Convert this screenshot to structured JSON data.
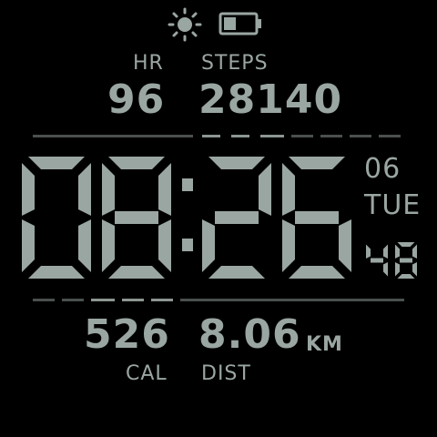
{
  "status": {
    "weather_icon": "sun-icon",
    "battery_icon": "battery-icon",
    "battery_level_fraction": 0.4
  },
  "colors": {
    "segment": "#9aa6a1",
    "background": "#000000",
    "dash_lit": "#8c9691",
    "dash_dim": "#4a504d"
  },
  "top_stats": {
    "hr_label": "HR",
    "hr_value": "96",
    "steps_label": "STEPS",
    "steps_value": "28140"
  },
  "time": {
    "hours": "08",
    "minutes": "26",
    "seconds": "48"
  },
  "date": {
    "day": "06",
    "weekday": "TUE"
  },
  "bottom_stats": {
    "cal_value": "526",
    "cal_label": "CAL",
    "dist_value": "8.06",
    "dist_unit": "KM",
    "dist_label": "DIST"
  }
}
